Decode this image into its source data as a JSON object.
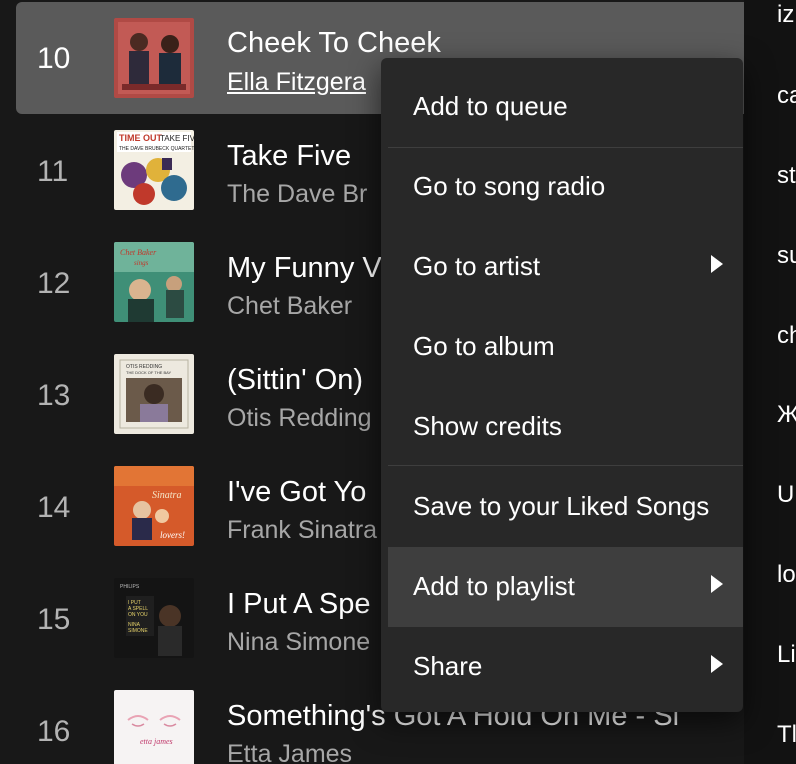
{
  "tracks": [
    {
      "number": "10",
      "title": "Cheek To Cheek",
      "artist": "Ella Fitzgera",
      "album_art_text": ""
    },
    {
      "number": "11",
      "title": "Take Five",
      "artist": "The Dave Br",
      "album_art_text": "TIME OUT TAKE FIVE THE DAVE BRUBECK QUARTET"
    },
    {
      "number": "12",
      "title": "My Funny V",
      "artist": "Chet Baker",
      "album_art_text": "Chet Baker sings"
    },
    {
      "number": "13",
      "title": "(Sittin' On)",
      "artist": "Otis Redding",
      "album_art_text": "OTIS REDDING THE DOCK OF THE BAY"
    },
    {
      "number": "14",
      "title": "I've Got Yo",
      "artist": "Frank Sinatra",
      "album_art_text": "Sinatra lovers!"
    },
    {
      "number": "15",
      "title": "I Put A Spe",
      "artist": "Nina Simone",
      "album_art_text": "I PUT A SPELL ON YOU NINA SIMONE"
    },
    {
      "number": "16",
      "title": "Something's Got A Hold On Me - Si",
      "artist": "Etta James",
      "album_art_text": "etta james"
    }
  ],
  "context_menu": {
    "items": [
      {
        "label": "Add to queue",
        "submenu": false
      },
      {
        "label": "Go to song radio",
        "submenu": false
      },
      {
        "label": "Go to artist",
        "submenu": true
      },
      {
        "label": "Go to album",
        "submenu": false
      },
      {
        "label": "Show credits",
        "submenu": false
      },
      {
        "label": "Save to your Liked Songs",
        "submenu": false
      },
      {
        "label": "Add to playlist",
        "submenu": true,
        "hovered": true
      },
      {
        "label": "Share",
        "submenu": true
      }
    ]
  },
  "right_panel": {
    "items": [
      "iz",
      "ca",
      "st",
      "su",
      "ch",
      "Ж",
      "U",
      "lo",
      "Li",
      "Tl"
    ]
  },
  "colors": {
    "background": "#181818",
    "selected_row": "#5a5a5a",
    "menu_background": "#282828",
    "menu_hover": "#3e3e3e",
    "text_primary": "#ffffff",
    "text_secondary": "#a7a7a7"
  }
}
